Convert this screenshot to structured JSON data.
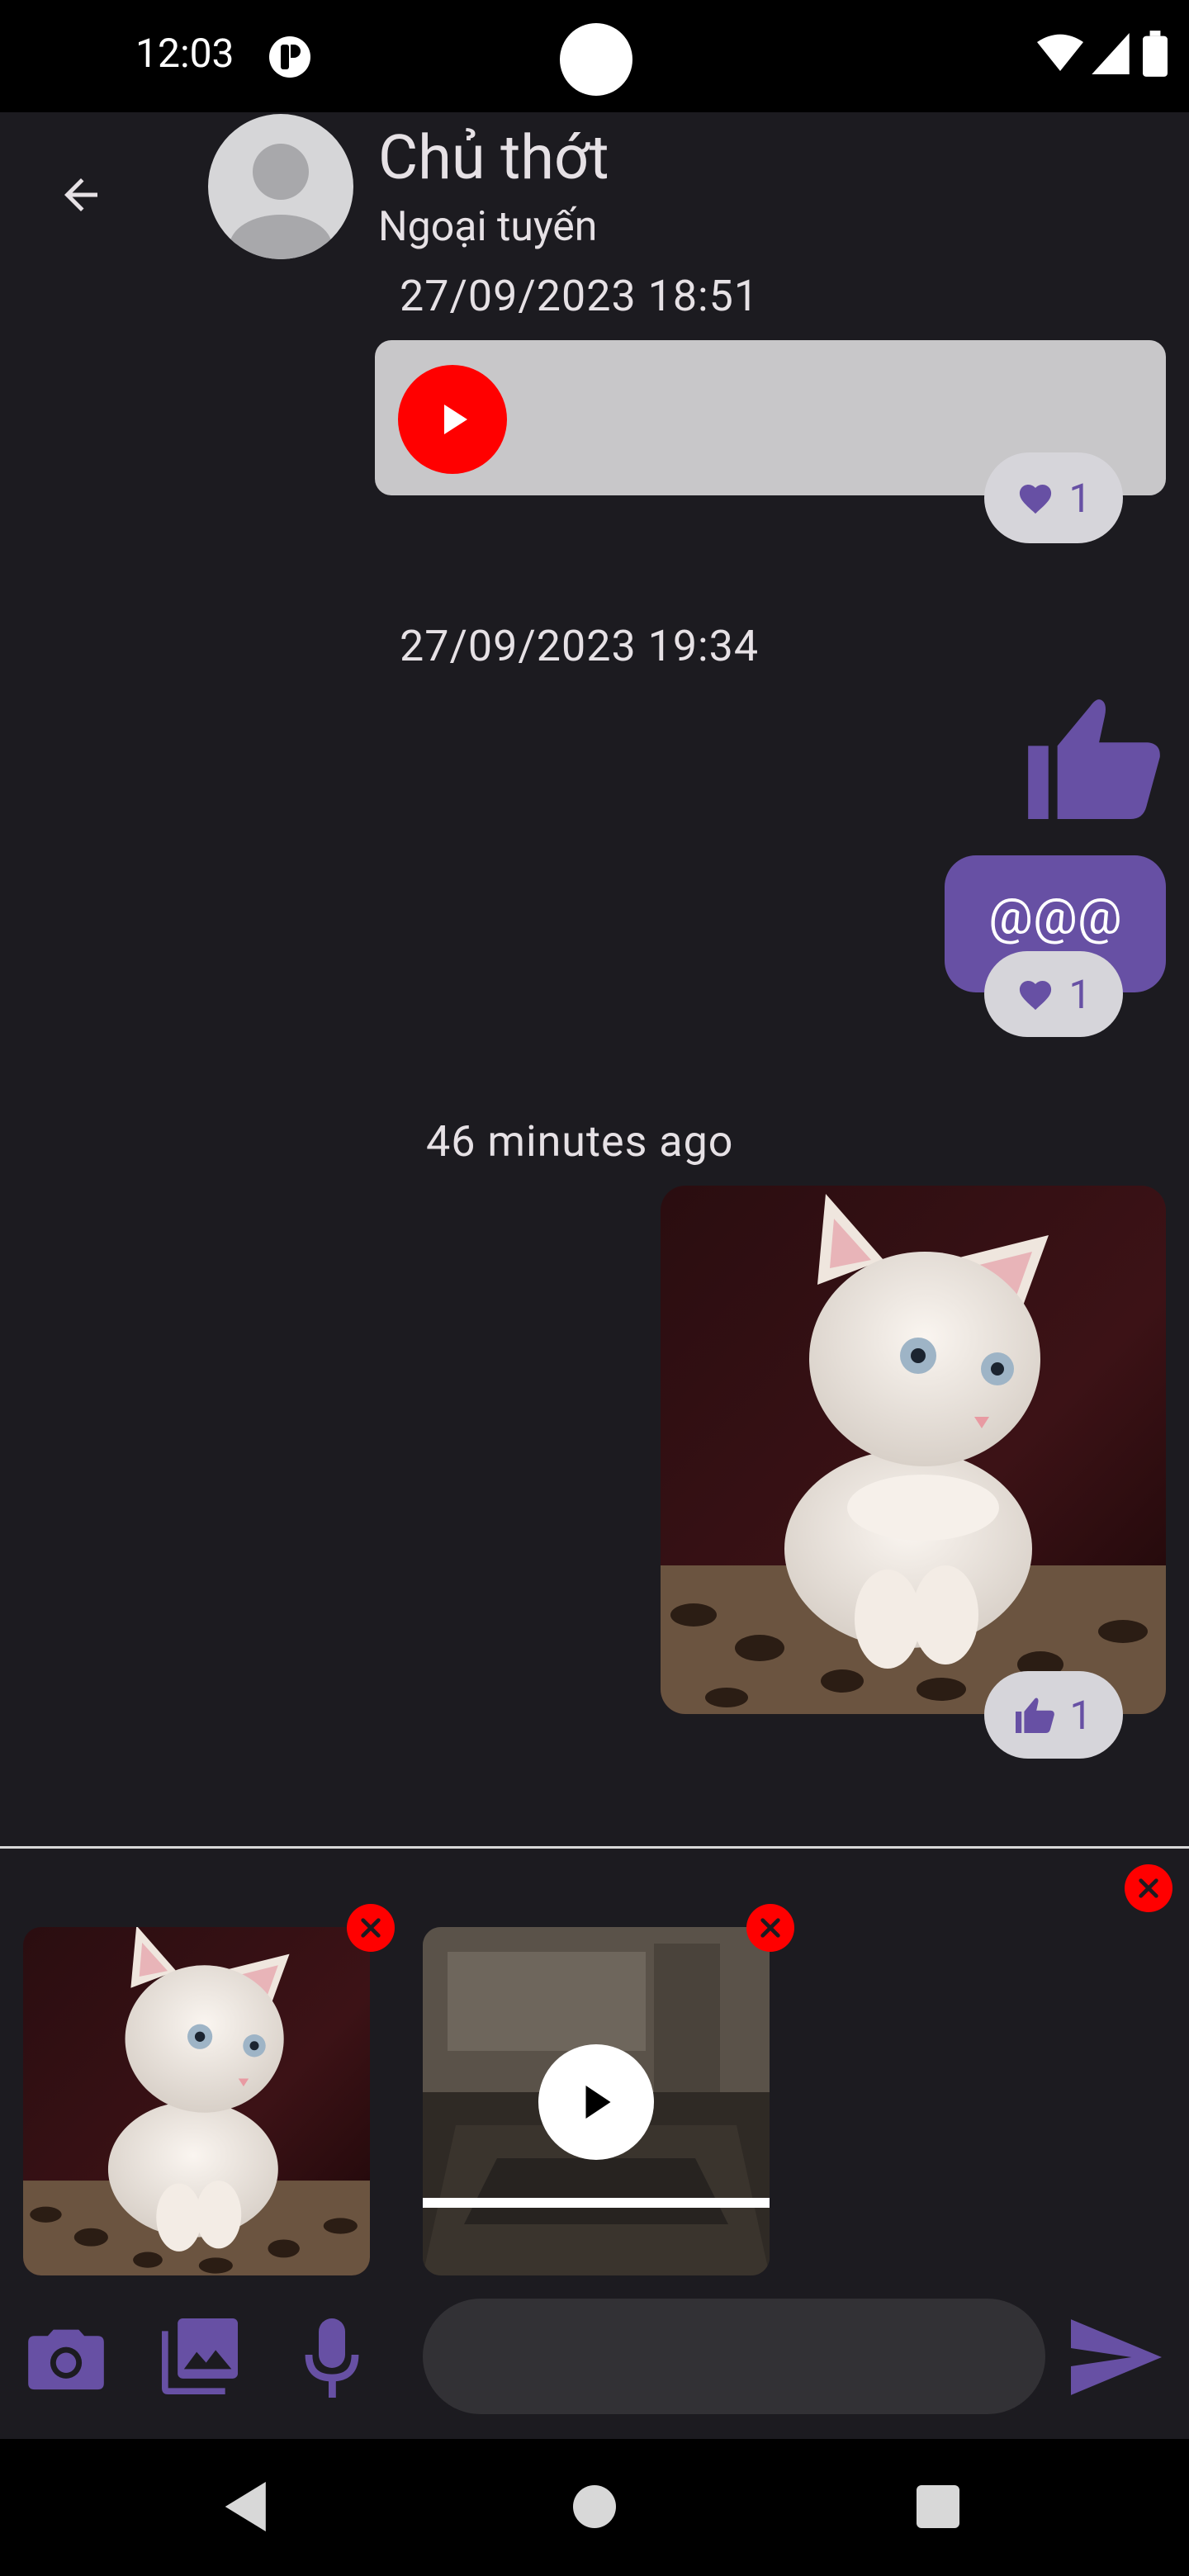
{
  "status_bar": {
    "time": "12:03"
  },
  "header": {
    "contact_name": "Chủ thớt",
    "contact_status": "Ngoại tuyến"
  },
  "messages": [
    {
      "timestamp": "27/09/2023 18:51",
      "type": "video-link",
      "reaction": {
        "icon": "heart-icon",
        "count": "1"
      }
    },
    {
      "timestamp": "27/09/2023 19:34",
      "type": "thumbs-up-sticker"
    },
    {
      "type": "text",
      "text": "@@@",
      "reaction": {
        "icon": "heart-icon",
        "count": "1"
      }
    },
    {
      "timestamp": "46 minutes ago",
      "type": "image",
      "reaction": {
        "icon": "thumbs-up-icon",
        "count": "1"
      }
    }
  ],
  "attachments": [
    {
      "type": "image",
      "kind": "kitten-photo"
    },
    {
      "type": "video",
      "kind": "room-video",
      "progress": 1.0
    }
  ],
  "input": {
    "value": "",
    "placeholder": ""
  },
  "colors": {
    "accent": "#6750a4",
    "background": "#1c1b20",
    "remove": "#ff0000",
    "bubble_gray": "#c8c7c9",
    "reaction_bg": "#d6d5da"
  }
}
